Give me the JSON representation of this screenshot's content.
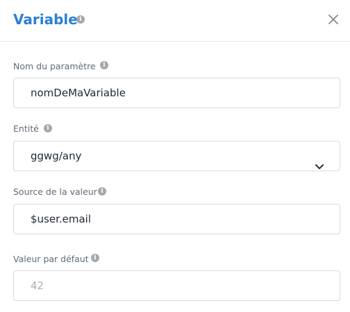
{
  "dialog": {
    "title": "Variable",
    "info_icon": "info-icon",
    "close_icon": "close-icon"
  },
  "fields": {
    "name": {
      "label": "Nom du paramètre",
      "value": "nomDeMaVariable"
    },
    "entity": {
      "label": "Entité",
      "value": "ggwg/any",
      "icon": "chevron-down-icon"
    },
    "source": {
      "label": "Source de la valeur",
      "value": "$user.email"
    },
    "default": {
      "label": "Valeur par défaut",
      "placeholder": "42"
    }
  },
  "colors": {
    "accent": "#2a7fd4",
    "label": "#5e6b78",
    "border": "#d5d9de",
    "placeholder": "#a9b0b7"
  }
}
